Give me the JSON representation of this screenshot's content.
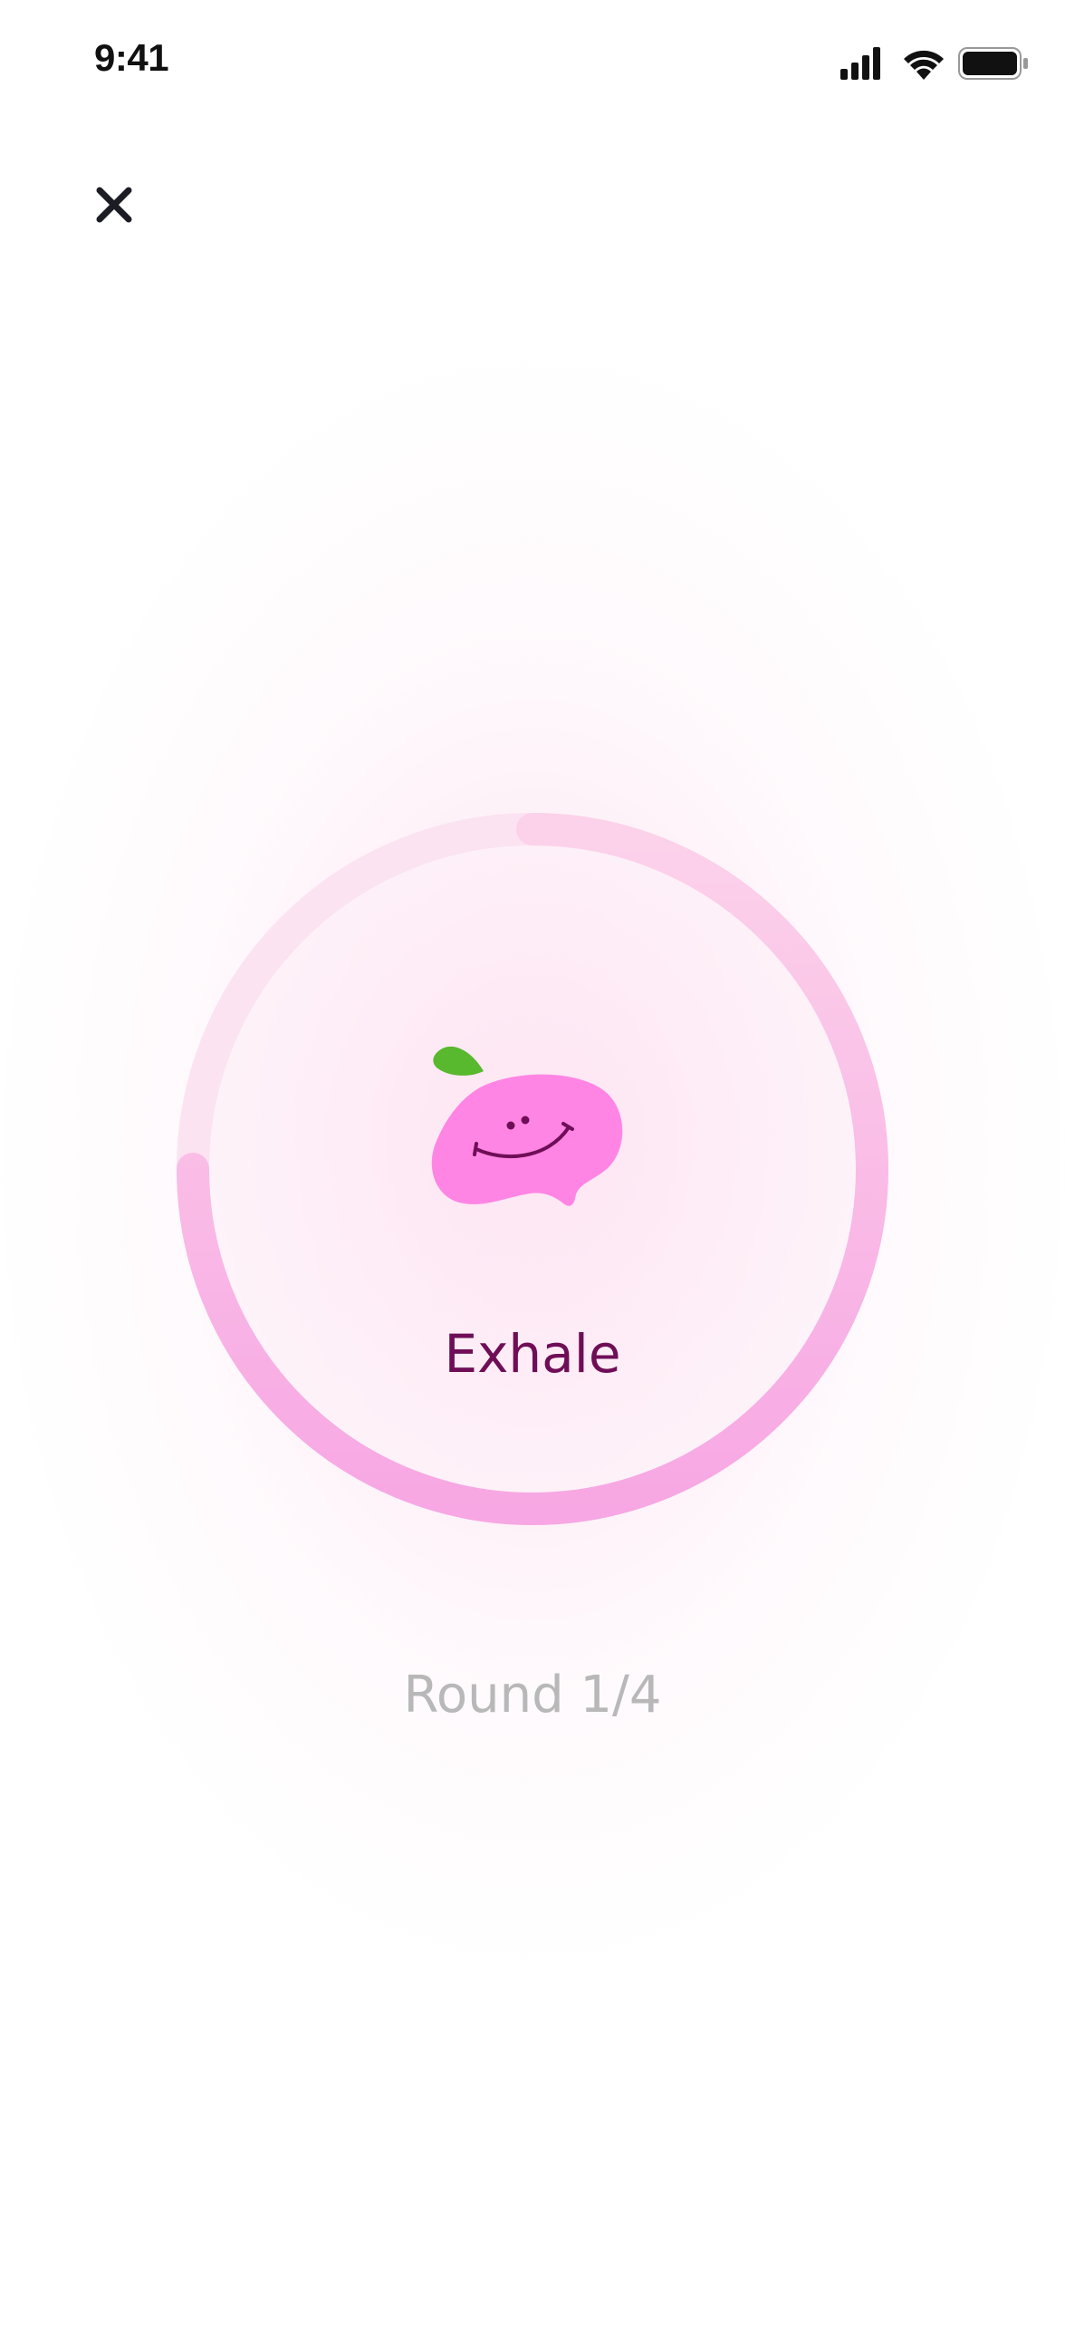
{
  "status_bar": {
    "time": "9:41",
    "icons": [
      "cellular-signal-icon",
      "wifi-icon",
      "battery-icon"
    ]
  },
  "header": {
    "close_icon": "close-icon"
  },
  "breathing": {
    "phase": "Exhale",
    "round_text": "Round 1/4",
    "progress_fraction": 0.75,
    "mascot_icon": "smiling-blob-mascot-icon"
  },
  "colors": {
    "phase_text": "#6f0e57",
    "round_text": "#b8b8b8",
    "progress_fill": "#f7a5e0",
    "progress_track": "#fbe3f1",
    "mascot_body": "#ff85e4",
    "mascot_leaf": "#58b82e"
  }
}
